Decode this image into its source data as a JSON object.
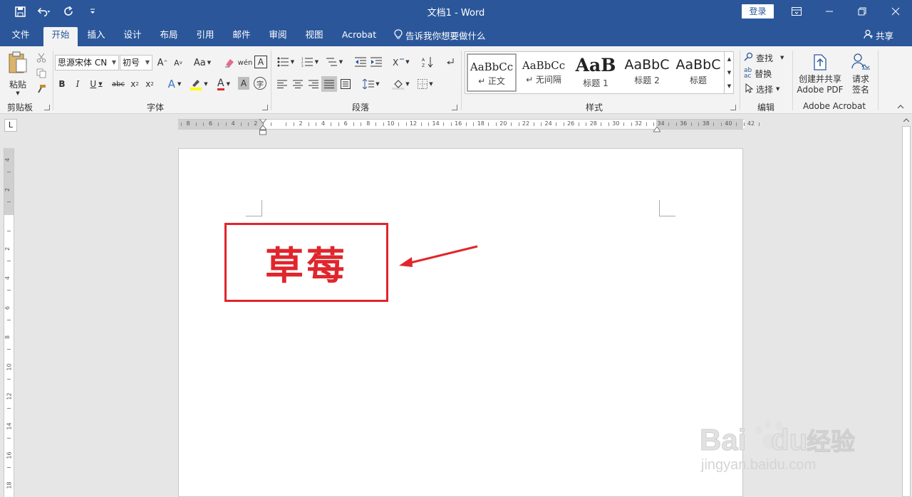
{
  "window": {
    "title": "文档1  -  Word",
    "login_label": "登录"
  },
  "tabs": [
    {
      "label": "文件"
    },
    {
      "label": "开始"
    },
    {
      "label": "插入"
    },
    {
      "label": "设计"
    },
    {
      "label": "布局"
    },
    {
      "label": "引用"
    },
    {
      "label": "邮件"
    },
    {
      "label": "审阅"
    },
    {
      "label": "视图"
    },
    {
      "label": "Acrobat"
    }
  ],
  "tell_me": "告诉我你想要做什么",
  "share_label": "共享",
  "ribbon": {
    "clipboard": {
      "paste_label": "粘贴",
      "group_label": "剪贴板"
    },
    "font": {
      "font_name": "思源宋体 CN",
      "font_size": "初号",
      "change_case": "Aa",
      "group_label": "字体"
    },
    "paragraph": {
      "group_label": "段落"
    },
    "styles": {
      "group_label": "样式",
      "items": [
        {
          "preview": "AaBbCc",
          "name": "↵ 正文"
        },
        {
          "preview": "AaBbCc",
          "name": "↵ 无间隔"
        },
        {
          "preview": "AaB",
          "name": "标题 1"
        },
        {
          "preview": "AaBbC",
          "name": "标题 2"
        },
        {
          "preview": "AaBbC",
          "name": "标题"
        }
      ]
    },
    "editing": {
      "find": "查找",
      "replace": "替换",
      "select": "选择",
      "group_label": "编辑"
    },
    "acrobat": {
      "create_share": "创建并共享",
      "adobe_pdf": "Adobe PDF",
      "request": "请求",
      "sign": "签名",
      "group_label": "Adobe Acrobat"
    }
  },
  "ruler": {
    "h_ticks": [
      "8",
      "6",
      "4",
      "2",
      "",
      "2",
      "4",
      "6",
      "8",
      "10",
      "12",
      "14",
      "16",
      "18",
      "20",
      "22",
      "24",
      "26",
      "28",
      "30",
      "32",
      "34",
      "36",
      "38",
      "40",
      "42"
    ],
    "v_ticks": [
      "4",
      "2",
      "",
      "2",
      "4",
      "6",
      "8",
      "10",
      "12",
      "14",
      "16",
      "18"
    ]
  },
  "document": {
    "text": "草莓"
  },
  "watermark": {
    "brand": "Bai du 经验",
    "url": "jingyan.baidu.com"
  },
  "colors": {
    "word_blue": "#2b579a",
    "annotation_red": "#e0262c"
  }
}
